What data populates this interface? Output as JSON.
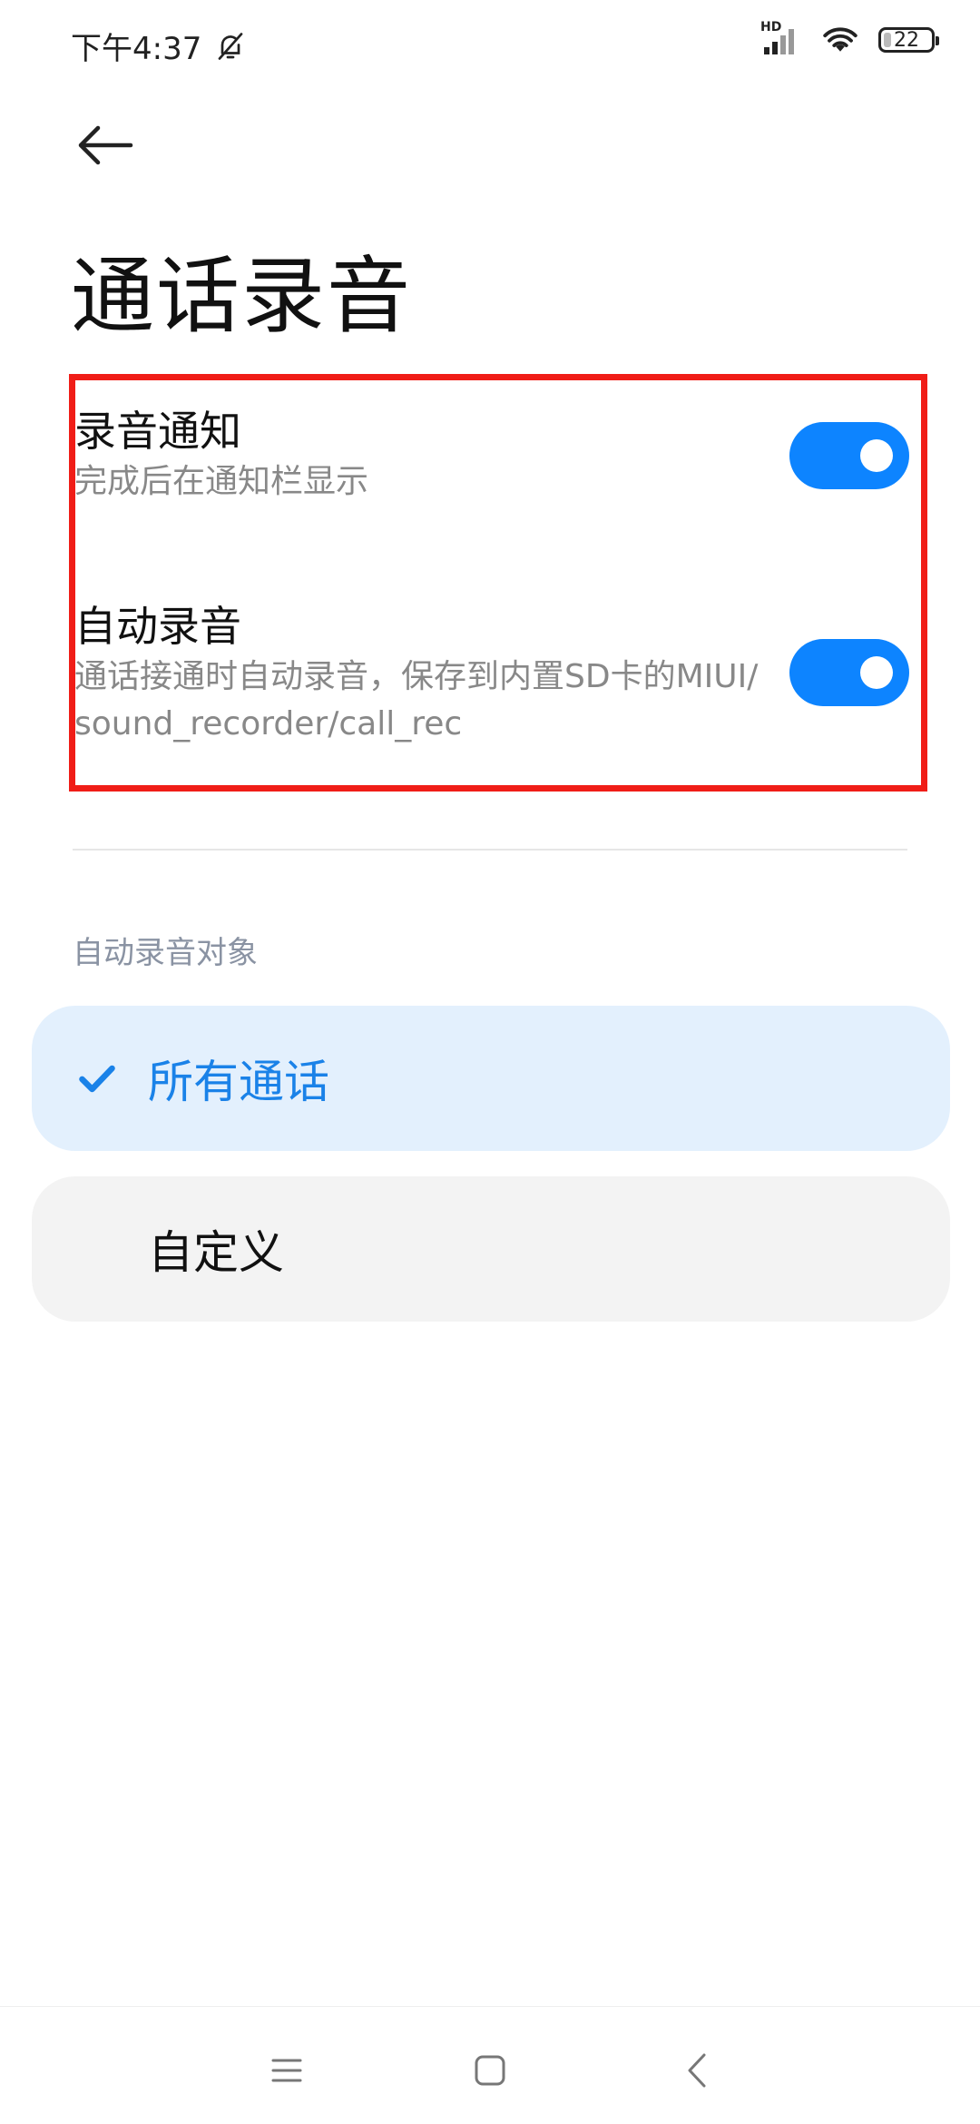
{
  "status_bar": {
    "time": "下午4:37",
    "network": "HD",
    "battery": "22"
  },
  "header": {
    "title": "通话录音"
  },
  "settings": [
    {
      "title": "录音通知",
      "description": "完成后在通知栏显示",
      "enabled": true
    },
    {
      "title": "自动录音",
      "description": "通话接通时自动录音，保存到内置SD卡的MIUI/sound_recorder/call_rec",
      "enabled": true
    }
  ],
  "auto_record_section": {
    "label": "自动录音对象",
    "options": [
      {
        "label": "所有通话",
        "selected": true
      },
      {
        "label": "自定义",
        "selected": false
      }
    ]
  },
  "colors": {
    "accent": "#0d84ff",
    "highlight_border": "#f01d17",
    "selected_bg": "#e3f0fd",
    "option_bg": "#f3f3f3"
  },
  "icons": {
    "back": "arrow-left-icon",
    "mute": "bell-off-icon",
    "signal": "signal-icon",
    "wifi": "wifi-icon",
    "check": "check-icon",
    "nav_menu": "menu-icon",
    "nav_home": "home-icon",
    "nav_back": "chevron-left-icon"
  }
}
